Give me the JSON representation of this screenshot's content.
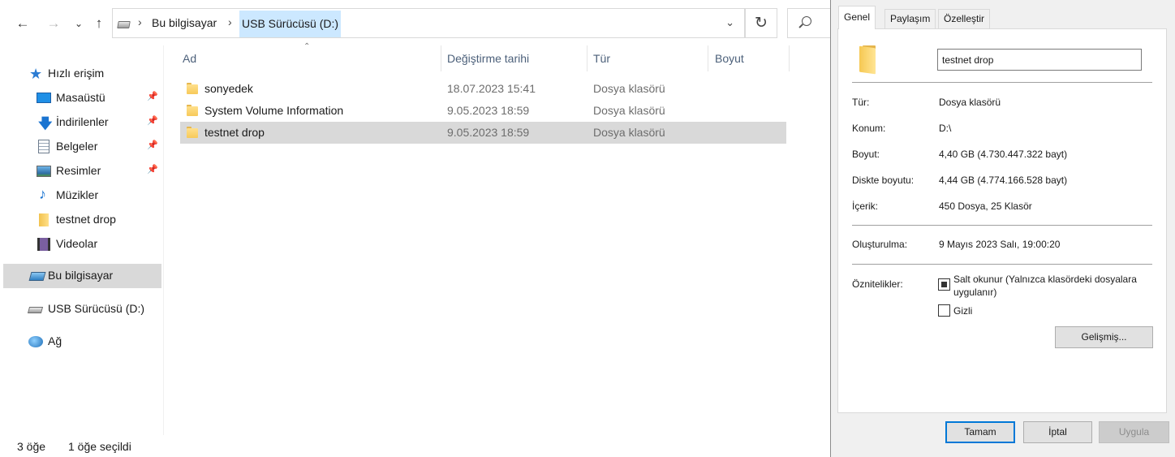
{
  "explorer": {
    "address": {
      "segments": [
        "Bu bilgisayar",
        "USB Sürücüsü (D:)"
      ]
    },
    "navigation": [
      {
        "label": "Hızlı erişim",
        "icon": "star-icon",
        "pinned": false
      },
      {
        "label": "Masaüstü",
        "icon": "desktop-icon",
        "pinned": true
      },
      {
        "label": "İndirilenler",
        "icon": "download-icon",
        "pinned": true
      },
      {
        "label": "Belgeler",
        "icon": "documents-icon",
        "pinned": true
      },
      {
        "label": "Resimler",
        "icon": "pictures-icon",
        "pinned": true
      },
      {
        "label": "Müzikler",
        "icon": "music-icon",
        "pinned": false
      },
      {
        "label": "testnet drop",
        "icon": "folder-icon",
        "pinned": false
      },
      {
        "label": "Videolar",
        "icon": "videos-icon",
        "pinned": false
      },
      {
        "label": "Bu bilgisayar",
        "icon": "computer-icon",
        "selected": true
      },
      {
        "label": "USB Sürücüsü (D:)",
        "icon": "usb-drive-icon"
      },
      {
        "label": "Ağ",
        "icon": "network-icon"
      }
    ],
    "columns": {
      "name": "Ad",
      "modified": "Değiştirme tarihi",
      "type": "Tür",
      "size": "Boyut"
    },
    "files": [
      {
        "name": "sonyedek",
        "modified": "18.07.2023 15:41",
        "type": "Dosya klasörü",
        "selected": false
      },
      {
        "name": "System Volume Information",
        "modified": "9.05.2023 18:59",
        "type": "Dosya klasörü",
        "selected": false
      },
      {
        "name": "testnet drop",
        "modified": "9.05.2023 18:59",
        "type": "Dosya klasörü",
        "selected": true
      }
    ],
    "status": {
      "item_count": "3 öğe",
      "selected_count": "1 öğe seçildi"
    }
  },
  "properties": {
    "tabs": [
      "Genel",
      "Paylaşım",
      "Özelleştir"
    ],
    "active_tab": "Genel",
    "folder_name": "testnet drop",
    "rows": {
      "type": {
        "label": "Tür:",
        "value": "Dosya klasörü"
      },
      "location": {
        "label": "Konum:",
        "value": "D:\\"
      },
      "size": {
        "label": "Boyut:",
        "value": "4,40 GB (4.730.447.322 bayt)"
      },
      "size_on_disk": {
        "label": "Diskte boyutu:",
        "value": "4,44 GB (4.774.166.528 bayt)"
      },
      "contains": {
        "label": "İçerik:",
        "value": "450 Dosya, 25 Klasör"
      },
      "created": {
        "label": "Oluşturulma:",
        "value": "9 Mayıs 2023 Salı, 19:00:20"
      }
    },
    "attributes": {
      "label": "Öznitelikler:",
      "readonly": "Salt okunur (Yalnızca klasördeki dosyalara uygulanır)",
      "readonly_state": "indeterminate",
      "hidden": "Gizli",
      "hidden_checked": false,
      "advanced_button": "Gelişmiş..."
    },
    "buttons": {
      "ok": "Tamam",
      "cancel": "İptal",
      "apply": "Uygula"
    }
  }
}
